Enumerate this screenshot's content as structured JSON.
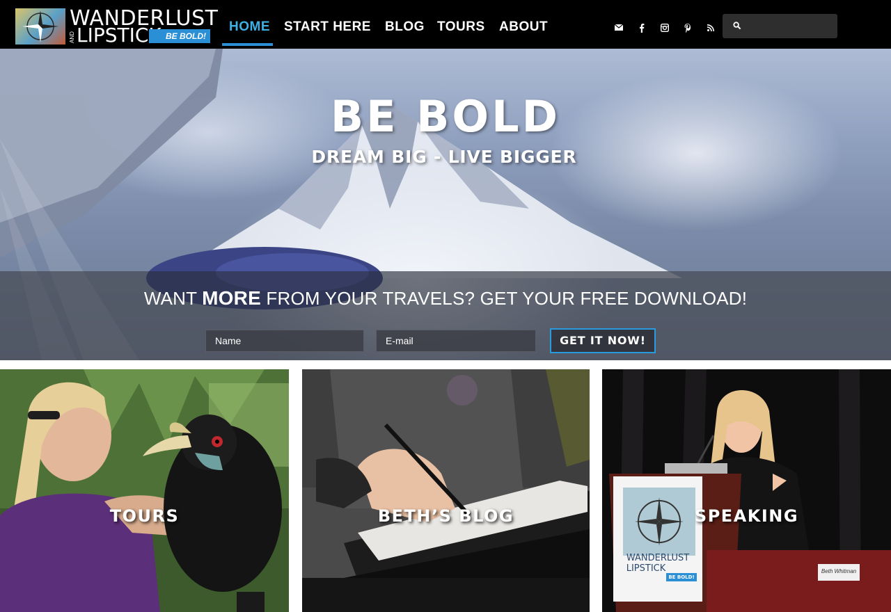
{
  "header": {
    "logo": {
      "line1": "WANDERLUST",
      "and": "AND",
      "line2": "LIPSTICK",
      "badge": "BE BOLD!"
    },
    "nav": [
      {
        "label": "HOME",
        "active": true
      },
      {
        "label": "START HERE",
        "active": false
      },
      {
        "label": "BLOG",
        "active": false
      },
      {
        "label": "TOURS",
        "active": false
      },
      {
        "label": "ABOUT",
        "active": false
      }
    ],
    "social_icons": [
      "mail-icon",
      "facebook-icon",
      "instagram-icon",
      "pinterest-icon",
      "rss-icon"
    ],
    "search": {
      "placeholder": ""
    }
  },
  "hero": {
    "title": "BE BOLD",
    "subtitle": "DREAM BIG - LIVE BIGGER",
    "optin": {
      "heading_pre": "WANT ",
      "heading_bold": "MORE",
      "heading_post": " FROM YOUR TRAVELS? GET YOUR FREE DOWNLOAD!",
      "name_placeholder": "Name",
      "email_placeholder": "E-mail",
      "cta_label": "GET IT NOW!"
    }
  },
  "cards": [
    {
      "label": "TOURS"
    },
    {
      "label": "BETH’S BLOG"
    },
    {
      "label": "SPEAKING"
    }
  ],
  "poster": {
    "line1": "WANDERLUST",
    "line2": "LIPSTICK",
    "badge": "BE BOLD!"
  },
  "name_placard": "Beth Whitman",
  "colors": {
    "accent": "#2b8fd6",
    "active_nav": "#3db0e6",
    "header_bg": "#000000"
  }
}
